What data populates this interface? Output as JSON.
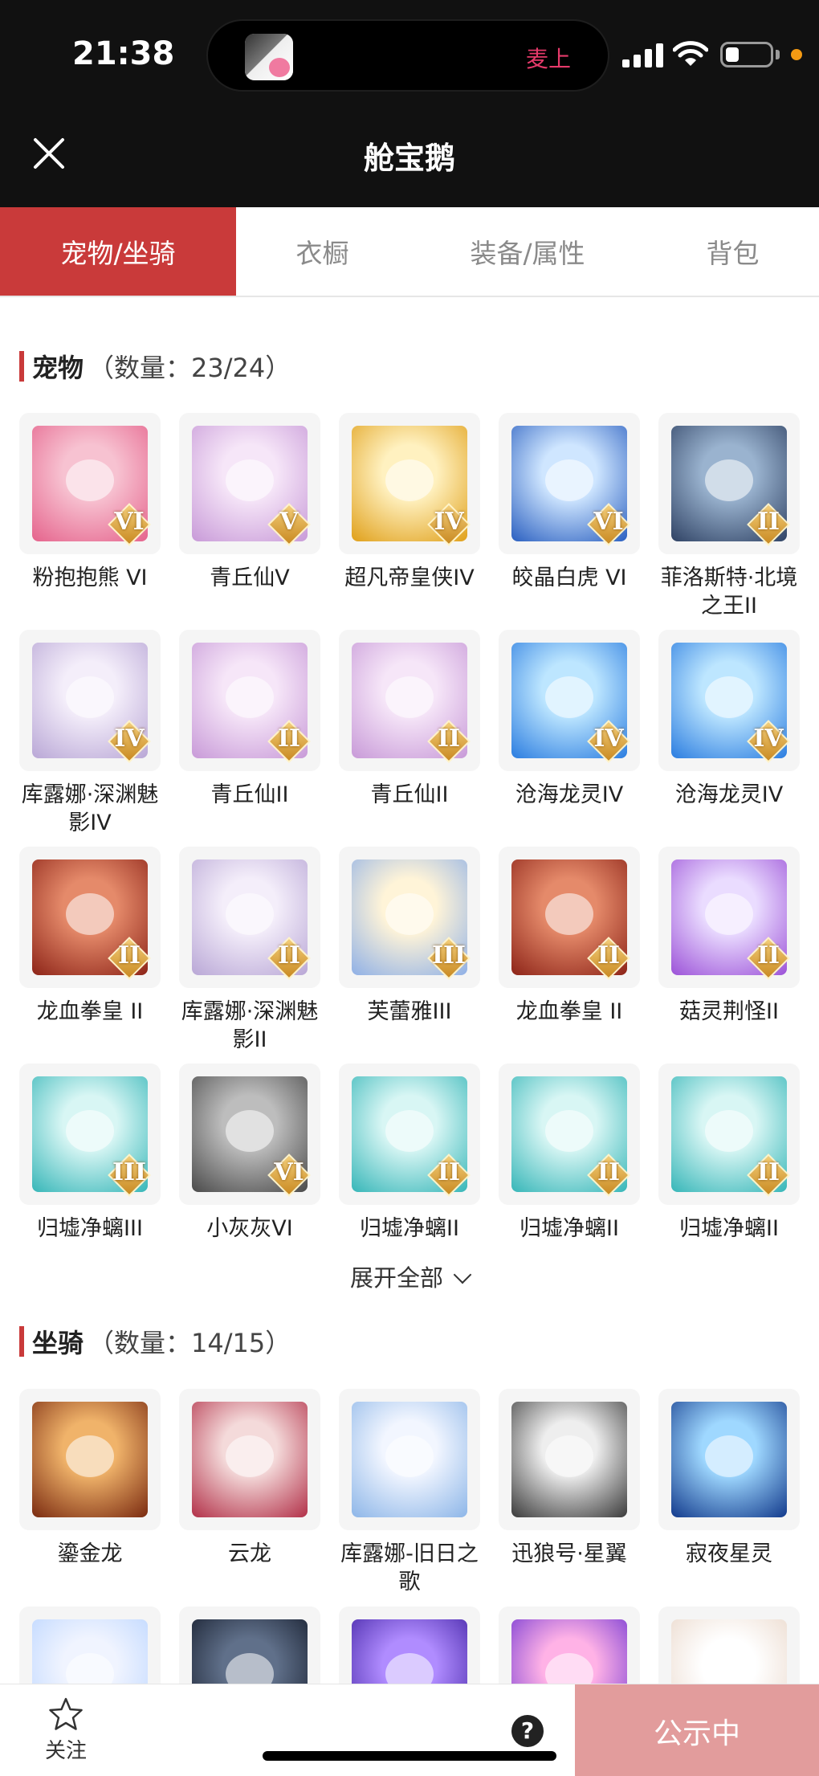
{
  "status_bar": {
    "time": "21:38",
    "island_text": "麦上"
  },
  "header": {
    "title": "舱宝鹅"
  },
  "tabs": [
    {
      "label": "宠物/坐骑",
      "active": true
    },
    {
      "label": "衣橱",
      "active": false
    },
    {
      "label": "装备/属性",
      "active": false
    },
    {
      "label": "背包",
      "active": false
    }
  ],
  "pets": {
    "title": "宠物",
    "count": "（数量：23/24）",
    "items": [
      {
        "name": "粉抱抱熊 VI",
        "badge": "VI",
        "art": "pink-bear"
      },
      {
        "name": "青丘仙V",
        "badge": "V",
        "art": "fox-fairy"
      },
      {
        "name": "超凡帝皇侠IV",
        "badge": "IV",
        "art": "golden-armor"
      },
      {
        "name": "皎晶白虎 VI",
        "badge": "VI",
        "art": "white-tiger"
      },
      {
        "name": "菲洛斯特·北境之王II",
        "badge": "II",
        "art": "frost-king"
      },
      {
        "name": "库露娜·深渊魅影IV",
        "badge": "IV",
        "art": "abyss-girl"
      },
      {
        "name": "青丘仙II",
        "badge": "II",
        "art": "fox-fairy"
      },
      {
        "name": "青丘仙II",
        "badge": "II",
        "art": "fox-fairy"
      },
      {
        "name": "沧海龙灵IV",
        "badge": "IV",
        "art": "sea-dragon-spirit"
      },
      {
        "name": "沧海龙灵IV",
        "badge": "IV",
        "art": "sea-dragon-spirit"
      },
      {
        "name": "龙血拳皇 II",
        "badge": "II",
        "art": "dragon-blood"
      },
      {
        "name": "库露娜·深渊魅影II",
        "badge": "II",
        "art": "abyss-girl"
      },
      {
        "name": "芙蕾雅III",
        "badge": "III",
        "art": "freya"
      },
      {
        "name": "龙血拳皇 II",
        "badge": "II",
        "art": "dragon-blood"
      },
      {
        "name": "菇灵荆怪II",
        "badge": "II",
        "art": "mushroom-spirit"
      },
      {
        "name": "归墟净螭III",
        "badge": "III",
        "art": "jade-dragon"
      },
      {
        "name": "小灰灰VI",
        "badge": "VI",
        "art": "grey-wolf"
      },
      {
        "name": "归墟净螭II",
        "badge": "II",
        "art": "jade-dragon"
      },
      {
        "name": "归墟净螭II",
        "badge": "II",
        "art": "jade-dragon"
      },
      {
        "name": "归墟净螭II",
        "badge": "II",
        "art": "jade-dragon"
      }
    ]
  },
  "expand_label": "展开全部",
  "mounts": {
    "title": "坐骑",
    "count": "（数量：14/15）",
    "items": [
      {
        "name": "鎏金龙",
        "art": "gold-dragon"
      },
      {
        "name": "云龙",
        "art": "cloud-dragon"
      },
      {
        "name": "库露娜-旧日之歌",
        "art": "song-girl"
      },
      {
        "name": "迅狼号·星翼",
        "art": "mecha-wolf"
      },
      {
        "name": "寂夜星灵",
        "art": "night-deer"
      },
      {
        "name": "",
        "art": "pale-horse"
      },
      {
        "name": "",
        "art": "dark-beast"
      },
      {
        "name": "",
        "art": "purple-mech"
      },
      {
        "name": "",
        "art": "heart-orb"
      },
      {
        "name": "",
        "art": "white-fox"
      }
    ]
  },
  "bottom_bar": {
    "follow_label": "关注",
    "help": "?",
    "cta_label": "公示中"
  },
  "art_colors": {
    "pink-bear": [
      "#f7c2d1",
      "#e5638c"
    ],
    "fox-fairy": [
      "#f6e6f8",
      "#c89ad8"
    ],
    "golden-armor": [
      "#fff1c0",
      "#e0a01a"
    ],
    "white-tiger": [
      "#cfe6ff",
      "#2a5fc0"
    ],
    "frost-king": [
      "#9ab3cf",
      "#2f4264"
    ],
    "abyss-girl": [
      "#f4eefa",
      "#b9a7d6"
    ],
    "sea-dragon-spirit": [
      "#bde6ff",
      "#2b7de0"
    ],
    "dragon-blood": [
      "#e58a6a",
      "#8d2418"
    ],
    "freya": [
      "#fff4d8",
      "#8fb0e6"
    ],
    "mushroom-spirit": [
      "#eadcff",
      "#9c52d8"
    ],
    "jade-dragon": [
      "#d8f6f4",
      "#36b6b8"
    ],
    "grey-wolf": [
      "#bdbdbd",
      "#4a4a4a"
    ],
    "gold-dragon": [
      "#f0b36a",
      "#7a2a10"
    ],
    "cloud-dragon": [
      "#f4dada",
      "#b23048"
    ],
    "song-girl": [
      "#f2f6ff",
      "#8db6e8"
    ],
    "mecha-wolf": [
      "#eeeeee",
      "#3a3a3a"
    ],
    "night-deer": [
      "#9fd8ff",
      "#123a8c"
    ],
    "pale-horse": [
      "#f0f4ff",
      "#b9d4ff"
    ],
    "dark-beast": [
      "#60708a",
      "#111827"
    ],
    "purple-mech": [
      "#b08cff",
      "#3d1ea0"
    ],
    "heart-orb": [
      "#ffb2e6",
      "#6a2fd1"
    ],
    "white-fox": [
      "#ffffff",
      "#e9d6c8"
    ]
  }
}
